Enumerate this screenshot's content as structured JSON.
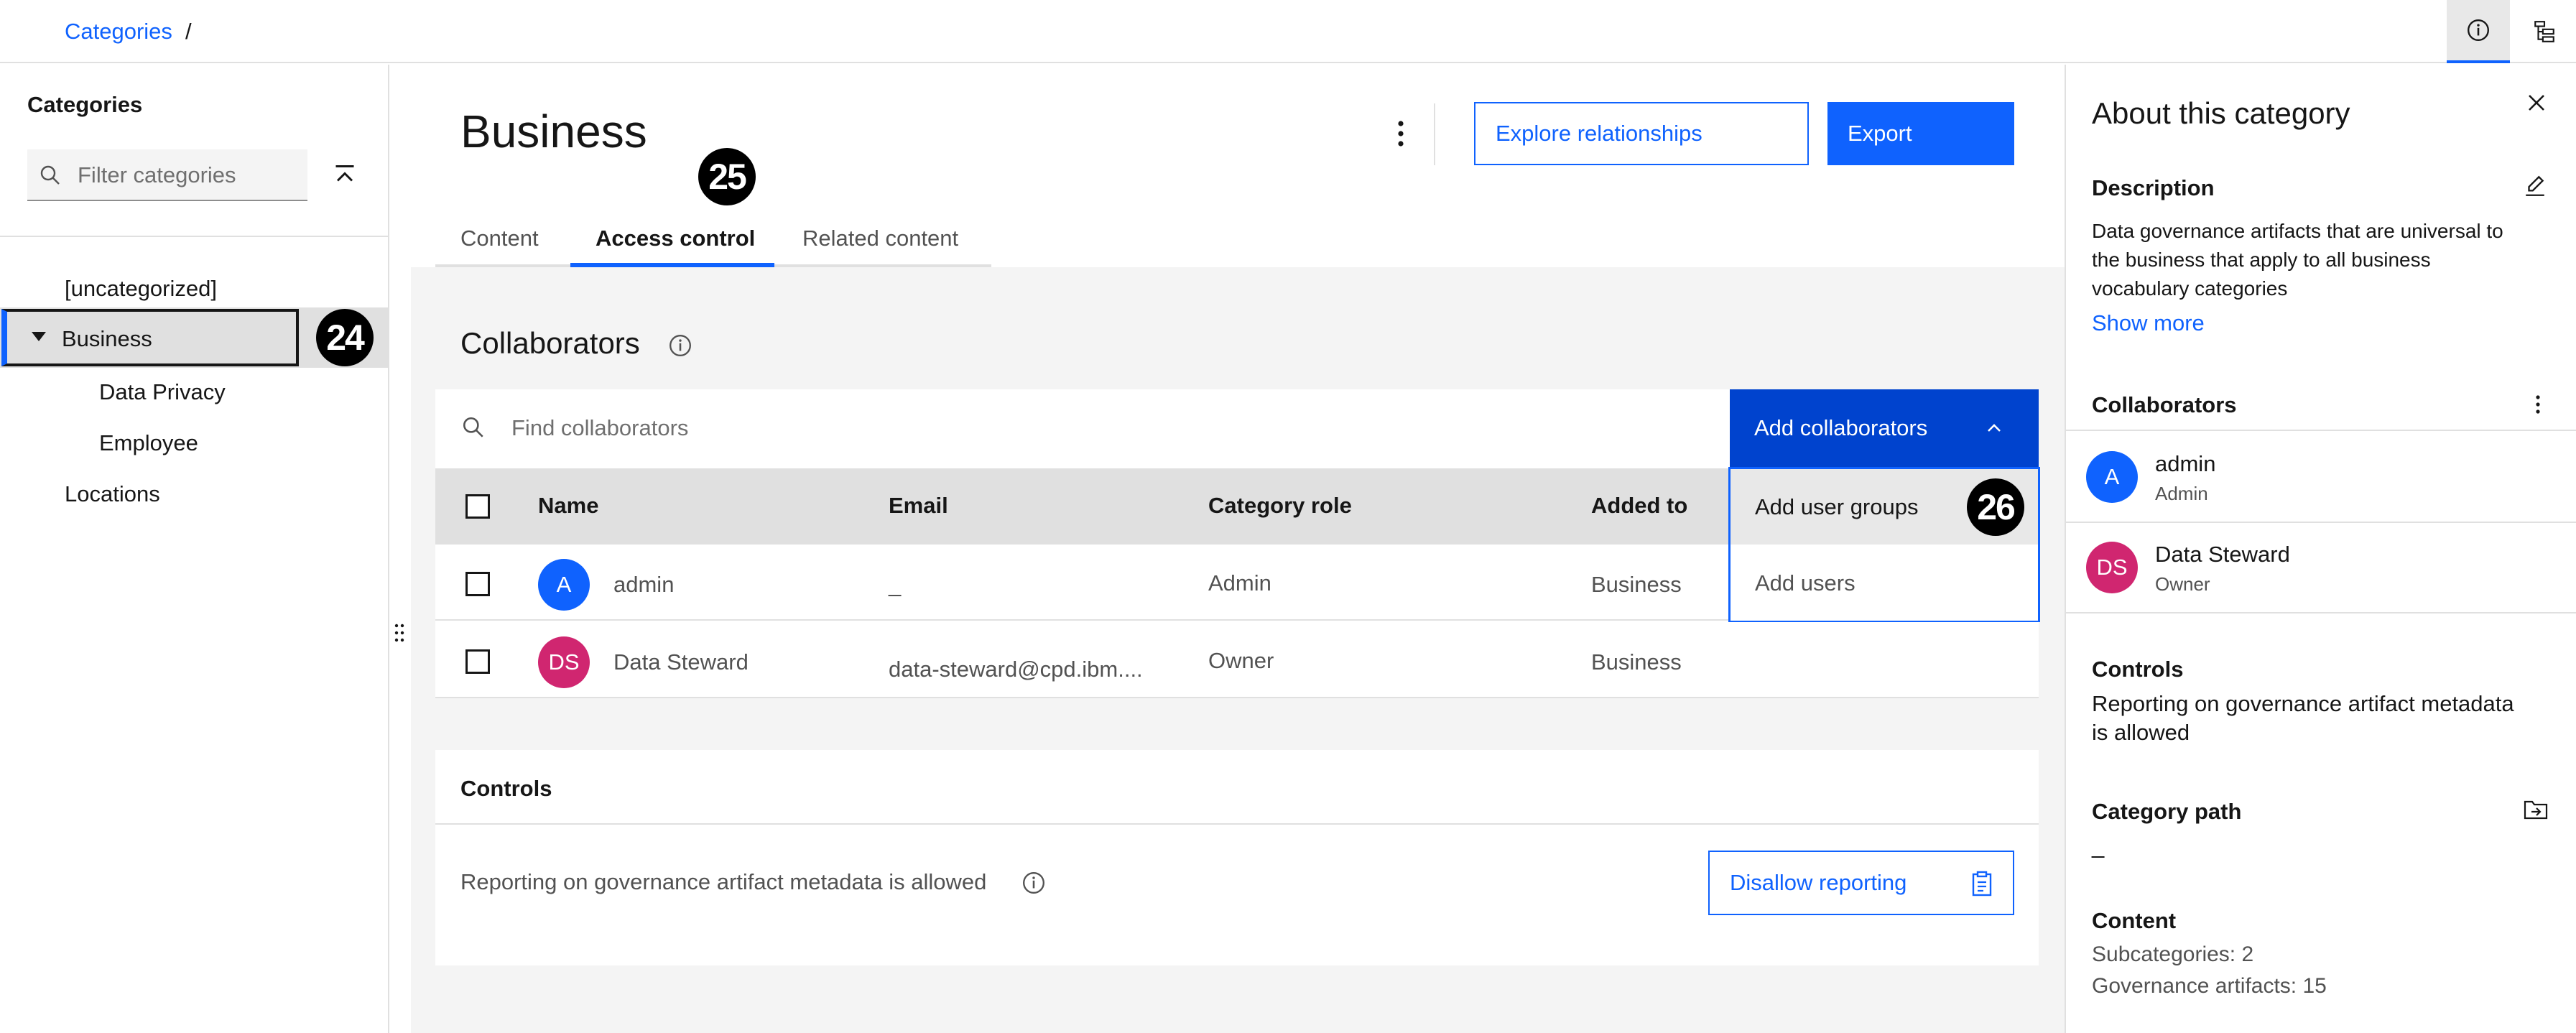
{
  "breadcrumb": {
    "link": "Categories",
    "separator": "/"
  },
  "left_panel": {
    "title": "Categories",
    "filter_placeholder": "Filter categories",
    "items": [
      {
        "label": "[uncategorized]"
      },
      {
        "label": "Business"
      },
      {
        "label": "Data Privacy"
      },
      {
        "label": "Employee"
      },
      {
        "label": "Locations"
      }
    ]
  },
  "annotations": {
    "a24": "24",
    "a25": "25",
    "a26": "26"
  },
  "header": {
    "title": "Business",
    "explore_button": "Explore relationships",
    "export_button": "Export"
  },
  "tabs": [
    {
      "label": "Content"
    },
    {
      "label": "Access control"
    },
    {
      "label": "Related content"
    }
  ],
  "collaborators": {
    "title": "Collaborators",
    "find_placeholder": "Find collaborators",
    "add_button": "Add collaborators",
    "menu": {
      "add_user_groups": "Add user groups",
      "add_users": "Add users"
    },
    "columns": {
      "name": "Name",
      "email": "Email",
      "role": "Category role",
      "added_to": "Added to"
    },
    "rows": [
      {
        "initials": "A",
        "name": "admin",
        "email": "_",
        "role": "Admin",
        "added_to": "Business"
      },
      {
        "initials": "DS",
        "name": "Data Steward",
        "email": "data-steward@cpd.ibm....",
        "role": "Owner",
        "added_to": "Business"
      }
    ]
  },
  "controls": {
    "title": "Controls",
    "text": "Reporting on governance artifact metadata is allowed",
    "button": "Disallow reporting"
  },
  "about": {
    "title": "About this category",
    "description_label": "Description",
    "description_lines": [
      "Data governance artifacts that are universal to",
      "the business that apply to all business",
      "vocabulary categories"
    ],
    "show_more": "Show more",
    "collaborators_label": "Collaborators",
    "collaborators": [
      {
        "initials": "A",
        "name": "admin",
        "role": "Admin"
      },
      {
        "initials": "DS",
        "name": "Data Steward",
        "role": "Owner"
      }
    ],
    "controls_label": "Controls",
    "controls_lines": [
      "Reporting on governance artifact metadata",
      "is allowed"
    ],
    "path_label": "Category path",
    "path_value": "_",
    "content_label": "Content",
    "subcategories": "Subcategories:  2",
    "governance_artifacts": "Governance artifacts:  15"
  },
  "colors": {
    "accent": "#0f62fe",
    "accent_dark": "#0043ce",
    "avatar_admin": "#0f62fe",
    "avatar_ds": "#d02670"
  },
  "icons": [
    "information-icon",
    "tree-view-icon",
    "search-icon",
    "collapse-all-icon",
    "overflow-menu-icon",
    "chevron-up-icon",
    "close-icon",
    "edit-icon",
    "folder-move-icon",
    "clipboard-icon",
    "drag-handle-icon",
    "caret-down-icon"
  ]
}
